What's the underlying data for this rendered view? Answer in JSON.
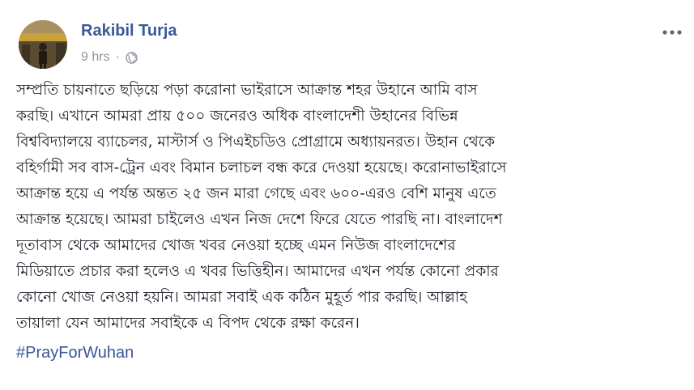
{
  "post": {
    "author": "Rakibil Turja",
    "time": "9 hrs",
    "separator": "·",
    "privacy_icon": "globe-icon",
    "menu_icon": "more-options-icon",
    "body_lines": [
      "সম্প্রতি চায়নাতে ছড়িয়ে পড়া করোনা ভাইরাসে আক্রান্ত শহর উহানে আমি বাস",
      "করছি। এখানে আমরা প্রায় ৫০০ জনেরও অধিক বাংলাদেশী উহানের বিভিন্ন",
      "বিশ্ববিদ্যালয়ে ব্যাচেলর, মাস্টার্স ও পিএইচডিও প্রোগ্রামে অধ্যায়নরত। উহান থেকে",
      "বহির্গামী সব বাস-ট্রেন এবং বিমান চলাচল বন্ধ করে দেওয়া হয়েছে। করোনাভাইরাসে",
      "আক্রান্ত হয়ে এ পর্যন্ত অন্তত ২৫ জন মারা গেছে এবং ৬০০-এরও বেশি মানুষ এতে",
      "আক্রান্ত হয়েছে। আমরা চাইলেও এখন নিজ দেশে ফিরে যেতে পারছি না। বাংলাদেশ",
      "দূতাবাস থেকে আমাদের খোজ খবর নেওয়া হচ্ছে এমন নিউজ বাংলাদেশের",
      "মিডিয়াতে প্রচার করা হলেও এ খবর ভিত্তিহীন। আমাদের এখন পর্যন্ত কোনো প্রকার",
      "কোনো খোজ নেওয়া হয়নি। আমরা সবাই এক কঠিন মুহূর্ত পার করছি। আল্লাহ",
      "তায়ালা যেন আমাদের সবাইকে এ বিপদ থেকে রক্ষা করেন।"
    ],
    "hashtag": "#PrayForWuhan"
  },
  "colors": {
    "link_blue": "#385898",
    "meta_gray": "#90949c",
    "text": "#1d2129"
  }
}
